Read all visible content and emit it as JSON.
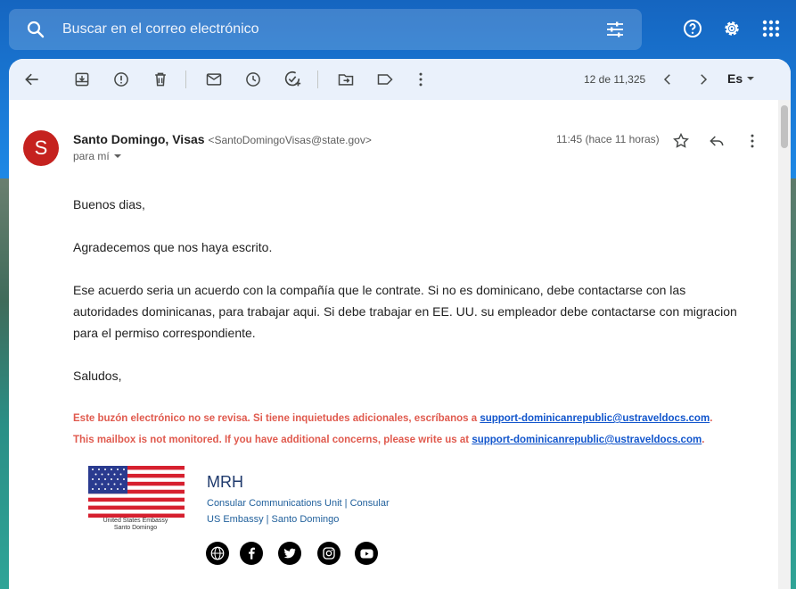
{
  "search": {
    "placeholder": "Buscar en el correo electrónico"
  },
  "top_icons": [
    "help-icon",
    "settings-icon",
    "apps-grid-icon"
  ],
  "toolbar": {
    "counter": "12 de 11,325",
    "language": "Es"
  },
  "message": {
    "avatar_letter": "S",
    "sender_name": "Santo Domingo, Visas",
    "sender_email": "<SantoDomingoVisas@state.gov>",
    "to": "para mí",
    "time": "11:45 (hace 11 horas)",
    "body": {
      "greeting": "Buenos dias,",
      "p1": "Agradecemos que nos haya escrito.",
      "p2_line1": "Ese acuerdo seria un acuerdo con la compañía que le contrate. Si no es dominicano, debe contactarse con las",
      "p2_line2": "autoridades dominicanas, para trabajar aqui. Si debe trabajar en EE. UU. su empleador debe contactarse con migracion",
      "p2_line3": "para el permiso correspondiente.",
      "closing": "Saludos,"
    },
    "notice_es_text": "Este buzón electrónico no se revisa. Si tiene inquietudes adicionales, escríbanos a ",
    "notice_en_text": "This mailbox is not monitored. If you have additional concerns, please write us at ",
    "notice_link": "support-dominicanrepublic@ustraveldocs.com",
    "notice_end": "."
  },
  "signature": {
    "flag_caption_line1": "United States Embassy",
    "flag_caption_line2": "Santo Domingo",
    "name": "MRH",
    "line1": "Consular Communications Unit | Consular",
    "line2": "US Embassy | Santo Domingo",
    "social": [
      "globe-icon",
      "facebook-icon",
      "twitter-icon",
      "instagram-icon",
      "youtube-icon"
    ]
  },
  "colors": {
    "avatar": "#c5221f",
    "warning_text": "#e05a4e",
    "link": "#1155cc",
    "toolbar_bg": "#eaf1fb"
  }
}
